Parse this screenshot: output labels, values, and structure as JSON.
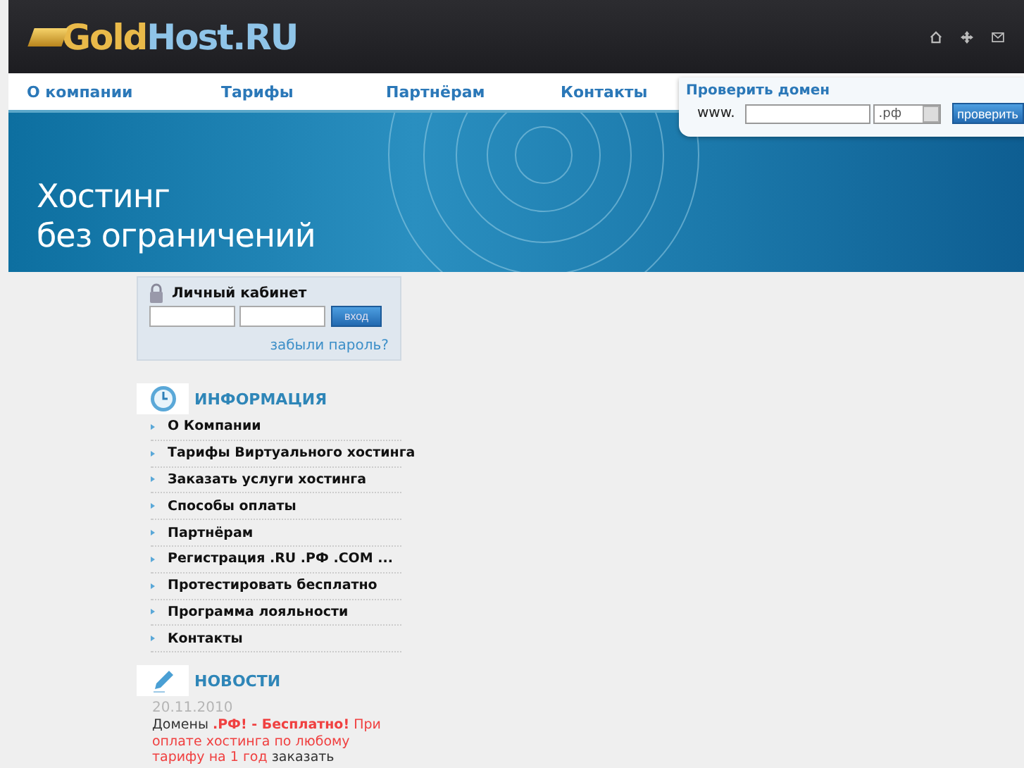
{
  "header": {
    "logo_gold": "Gold",
    "logo_rest": "Host.RU"
  },
  "nav": [
    {
      "label": "О компании"
    },
    {
      "label": "Тарифы"
    },
    {
      "label": "Партнёрам"
    },
    {
      "label": "Контакты"
    }
  ],
  "domain_check": {
    "title": "Проверить домен",
    "prefix": "www.",
    "zone": ".рф",
    "button": "проверить"
  },
  "banner": {
    "line1": "Хостинг",
    "line2": "без ограничений"
  },
  "login": {
    "title": "Личный кабинет",
    "button": "вход",
    "forgot": "забыли пароль?"
  },
  "info": {
    "title": "ИНФОРМАЦИЯ",
    "items": [
      "О Компании",
      "Тарифы Виртуального хостинга",
      "Заказать услуги хостинга",
      "Способы оплаты",
      "Партнёрам",
      "Регистрация .RU .РФ .COM ...",
      "Протестировать бесплатно",
      "Программа лояльности",
      "Контакты"
    ]
  },
  "news": {
    "title": "НОВОСТИ",
    "date": "20.11.2010",
    "parts": [
      {
        "kind": "plain",
        "text": "Домены "
      },
      {
        "kind": "alert-bold",
        "text": ".РФ! - Бесплатно!"
      },
      {
        "kind": "alert",
        "text": " При оплате хостинга по любому тарифу на 1 год"
      },
      {
        "kind": "plain",
        "text": " заказать"
      }
    ]
  }
}
